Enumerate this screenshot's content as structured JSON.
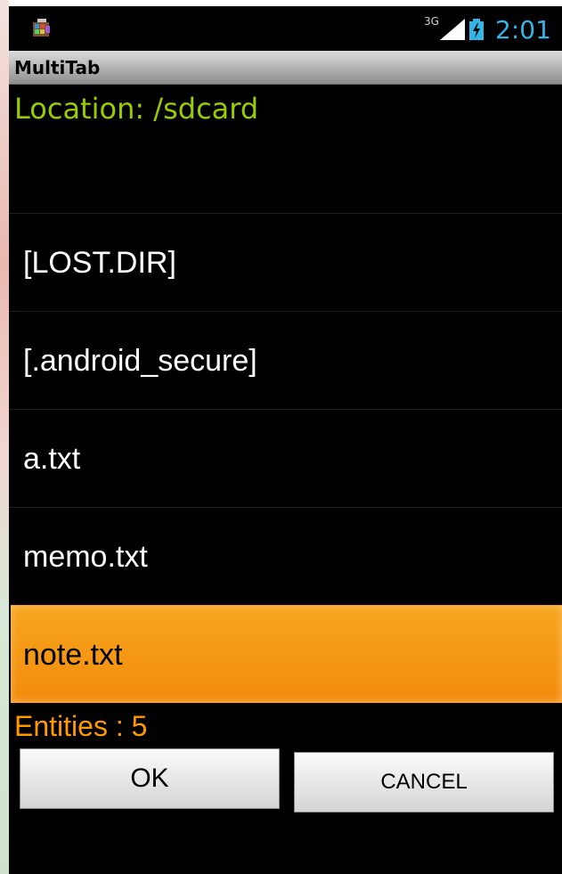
{
  "status_bar": {
    "network_label": "3G",
    "time": "2:01",
    "clock_color": "#33b5e5",
    "icons": [
      "app-notification-icon",
      "signal-icon",
      "battery-charging-icon"
    ]
  },
  "title_bar": {
    "title": "MultiTab"
  },
  "location": {
    "text": "Location: /sdcard",
    "color": "#99cc00"
  },
  "file_list": {
    "items": [
      {
        "label": "[LOST.DIR]",
        "selected": false
      },
      {
        "label": "[.android_secure]",
        "selected": false
      },
      {
        "label": "a.txt",
        "selected": false
      },
      {
        "label": "memo.txt",
        "selected": false
      },
      {
        "label": "note.txt",
        "selected": true
      }
    ],
    "selection_color": "#f7a51e"
  },
  "entities": {
    "text": "Entities : 5",
    "color": "#ff9900"
  },
  "buttons": {
    "ok_label": "OK",
    "cancel_label": "CANCEL"
  }
}
